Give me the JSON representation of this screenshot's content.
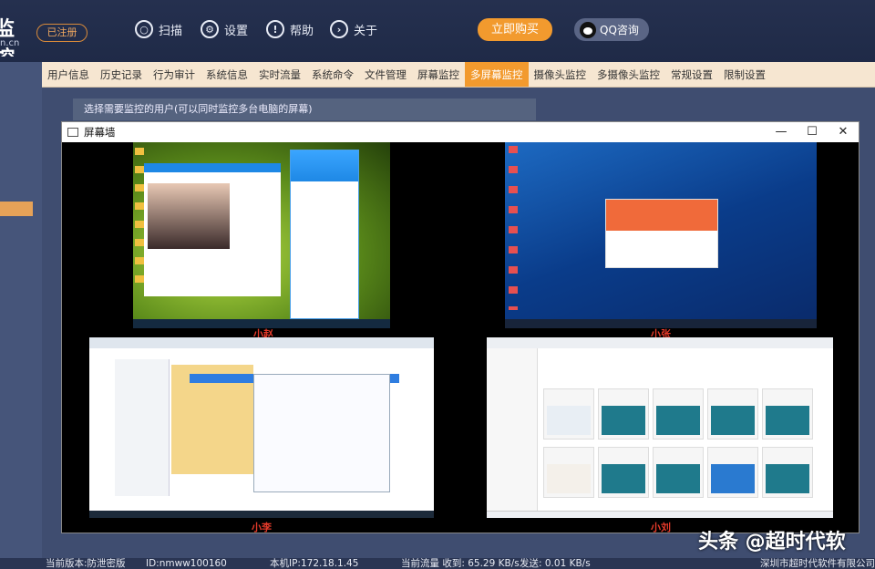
{
  "header": {
    "logo_text": "监控",
    "logo_sub": "n.cn",
    "registered_badge": "已注册",
    "scan_label": "扫描",
    "settings_label": "设置",
    "help_label": "帮助",
    "about_label": "关于",
    "buy_label": "立即购买",
    "qq_label": "QQ咨询"
  },
  "tabs": [
    {
      "label": "用户信息",
      "active": false
    },
    {
      "label": "历史记录",
      "active": false
    },
    {
      "label": "行为审计",
      "active": false
    },
    {
      "label": "系统信息",
      "active": false
    },
    {
      "label": "实时流量",
      "active": false
    },
    {
      "label": "系统命令",
      "active": false
    },
    {
      "label": "文件管理",
      "active": false
    },
    {
      "label": "屏幕监控",
      "active": false
    },
    {
      "label": "多屏幕监控",
      "active": true
    },
    {
      "label": "摄像头监控",
      "active": false
    },
    {
      "label": "多摄像头监控",
      "active": false
    },
    {
      "label": "常规设置",
      "active": false
    },
    {
      "label": "限制设置",
      "active": false
    }
  ],
  "hint": "选择需要监控的用户(可以同时监控多台电脑的屏幕)",
  "wall": {
    "title": "屏幕墙",
    "minimize": "—",
    "maximize": "☐",
    "close": "✕",
    "screens": [
      {
        "user": "小赵"
      },
      {
        "user": "小张"
      },
      {
        "user": "小李"
      },
      {
        "user": "小刘"
      }
    ]
  },
  "watermark": "头条 @超时代软",
  "status": {
    "version": "当前版本:防泄密版",
    "id": "ID:nmww100160",
    "ip": "本机IP:172.18.1.45",
    "traffic": "当前流量 收到: 65.29 KB/s",
    "send": "发送: 0.01 KB/s",
    "company": "深圳市超时代软件有限公司(c"
  },
  "colors": {
    "accent": "#f29a2e",
    "header": "#25304f",
    "tabbar": "#f6e6d1",
    "caption": "#e53a2a"
  }
}
